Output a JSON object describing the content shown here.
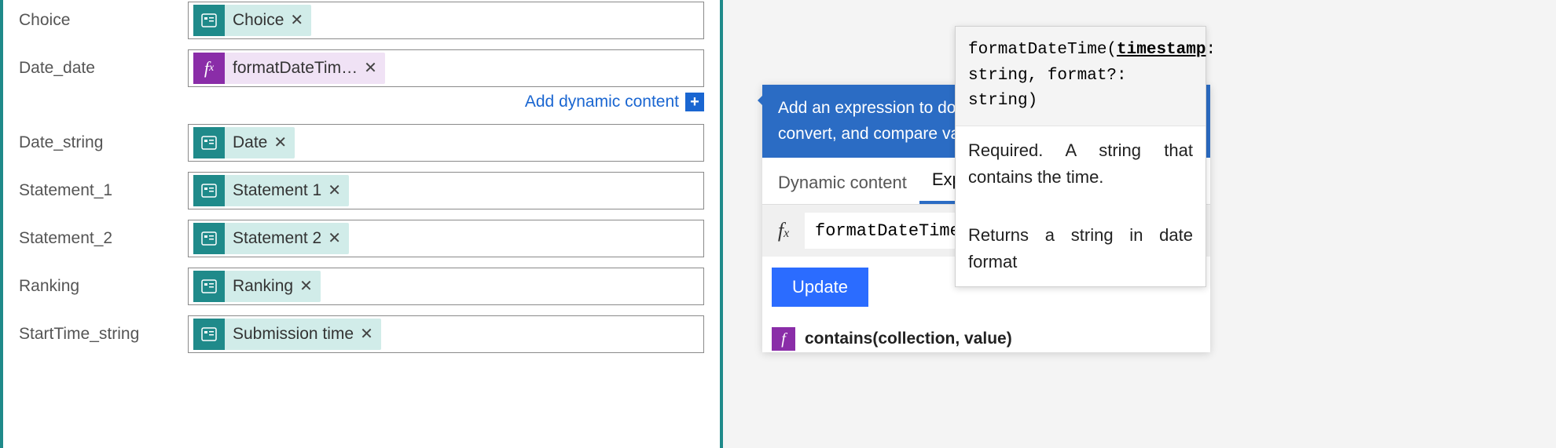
{
  "form": {
    "rows": [
      {
        "label": "Choice",
        "token_type": "forms",
        "token_label": "Choice"
      },
      {
        "label": "Date_date",
        "token_type": "fx",
        "token_label": "formatDateTim…"
      },
      {
        "label": "Date_string",
        "token_type": "forms",
        "token_label": "Date"
      },
      {
        "label": "Statement_1",
        "token_type": "forms",
        "token_label": "Statement 1"
      },
      {
        "label": "Statement_2",
        "token_type": "forms",
        "token_label": "Statement 2"
      },
      {
        "label": "Ranking",
        "token_type": "forms",
        "token_label": "Ranking"
      },
      {
        "label": "StartTime_string",
        "token_type": "forms",
        "token_label": "Submission time"
      }
    ],
    "dynamic_link": "Add dynamic content"
  },
  "expr_panel": {
    "header": "Add an expression to do basic things like access, convert, and compare values.",
    "tabs": {
      "dynamic": "Dynamic content",
      "expression": "Expression"
    },
    "fx_value": "formatDateTime(",
    "update": "Update",
    "fn_item": "contains(collection, value)"
  },
  "tooltip": {
    "sig_pre": "formatDateTime(",
    "sig_hl": "timestamp",
    "sig_post": ": string, format?: string)",
    "desc": "Required. A string that contains the time.",
    "returns": "Returns a string in date format"
  }
}
